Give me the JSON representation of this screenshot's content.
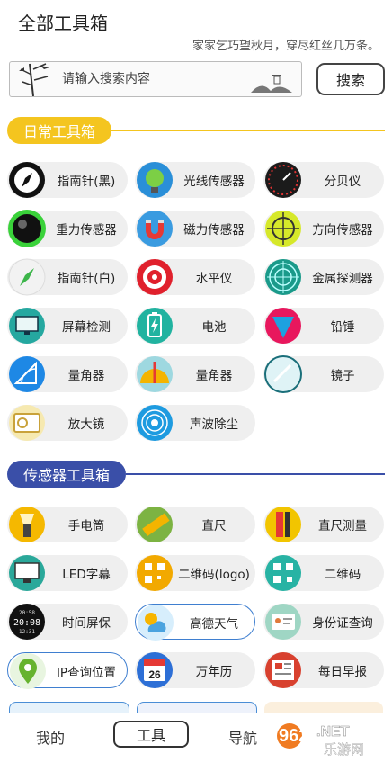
{
  "header": {
    "title": "全部工具箱",
    "slogan": "家家乞巧望秋月，穿尽红丝几万条。"
  },
  "search": {
    "placeholder": "请输入搜索内容",
    "button_label": "搜索"
  },
  "sections": {
    "daily": {
      "title": "日常工具箱",
      "color": "#f4c51f",
      "items": [
        {
          "label": "指南针(黑)",
          "icon": "compass-black-icon"
        },
        {
          "label": "光线传感器",
          "icon": "light-sensor-icon"
        },
        {
          "label": "分贝仪",
          "icon": "decibel-meter-icon"
        },
        {
          "label": "重力传感器",
          "icon": "gravity-sensor-icon"
        },
        {
          "label": "磁力传感器",
          "icon": "magnet-icon"
        },
        {
          "label": "方向传感器",
          "icon": "direction-sensor-icon"
        },
        {
          "label": "指南针(白)",
          "icon": "compass-white-icon"
        },
        {
          "label": "水平仪",
          "icon": "level-target-icon"
        },
        {
          "label": "金属探测器",
          "icon": "metal-detector-icon"
        },
        {
          "label": "屏幕检测",
          "icon": "screen-test-icon"
        },
        {
          "label": "电池",
          "icon": "battery-icon"
        },
        {
          "label": "铅锤",
          "icon": "plumb-bob-icon"
        },
        {
          "label": "量角器",
          "icon": "protractor-icon"
        },
        {
          "label": "量角器",
          "icon": "protractor-yellow-icon"
        },
        {
          "label": "镜子",
          "icon": "mirror-icon"
        },
        {
          "label": "放大镜",
          "icon": "magnifier-icon"
        },
        {
          "label": "声波除尘",
          "icon": "sound-wave-icon"
        }
      ]
    },
    "sensor": {
      "title": "传感器工具箱",
      "color": "#3a4fa8",
      "items": [
        {
          "label": "手电筒",
          "icon": "flashlight-icon"
        },
        {
          "label": "直尺",
          "icon": "ruler-icon"
        },
        {
          "label": "直尺测量",
          "icon": "ruler-measure-icon"
        },
        {
          "label": "LED字幕",
          "icon": "led-monitor-icon"
        },
        {
          "label": "二维码(logo)",
          "icon": "qr-logo-icon"
        },
        {
          "label": "二维码",
          "icon": "qr-code-icon"
        },
        {
          "label": "时间屏保",
          "icon": "digital-clock-icon"
        },
        {
          "label": "高德天气",
          "icon": "weather-icon"
        },
        {
          "label": "身份证查询",
          "icon": "id-card-icon"
        },
        {
          "label": "IP查询位置",
          "icon": "location-pin-icon"
        },
        {
          "label": "万年历",
          "icon": "calendar-icon"
        },
        {
          "label": "每日早报",
          "icon": "newspaper-icon"
        }
      ]
    }
  },
  "clock_text": {
    "top": "20:58",
    "main": "20:08",
    "bottom": "12:31"
  },
  "calendar_day": "26",
  "bottom_nav": {
    "tabs": [
      {
        "label": "我的"
      },
      {
        "label": "工具"
      },
      {
        "label": "导航"
      }
    ]
  },
  "watermark": {
    "brand": "962",
    "suffix": ".NET",
    "text": "乐游网"
  }
}
